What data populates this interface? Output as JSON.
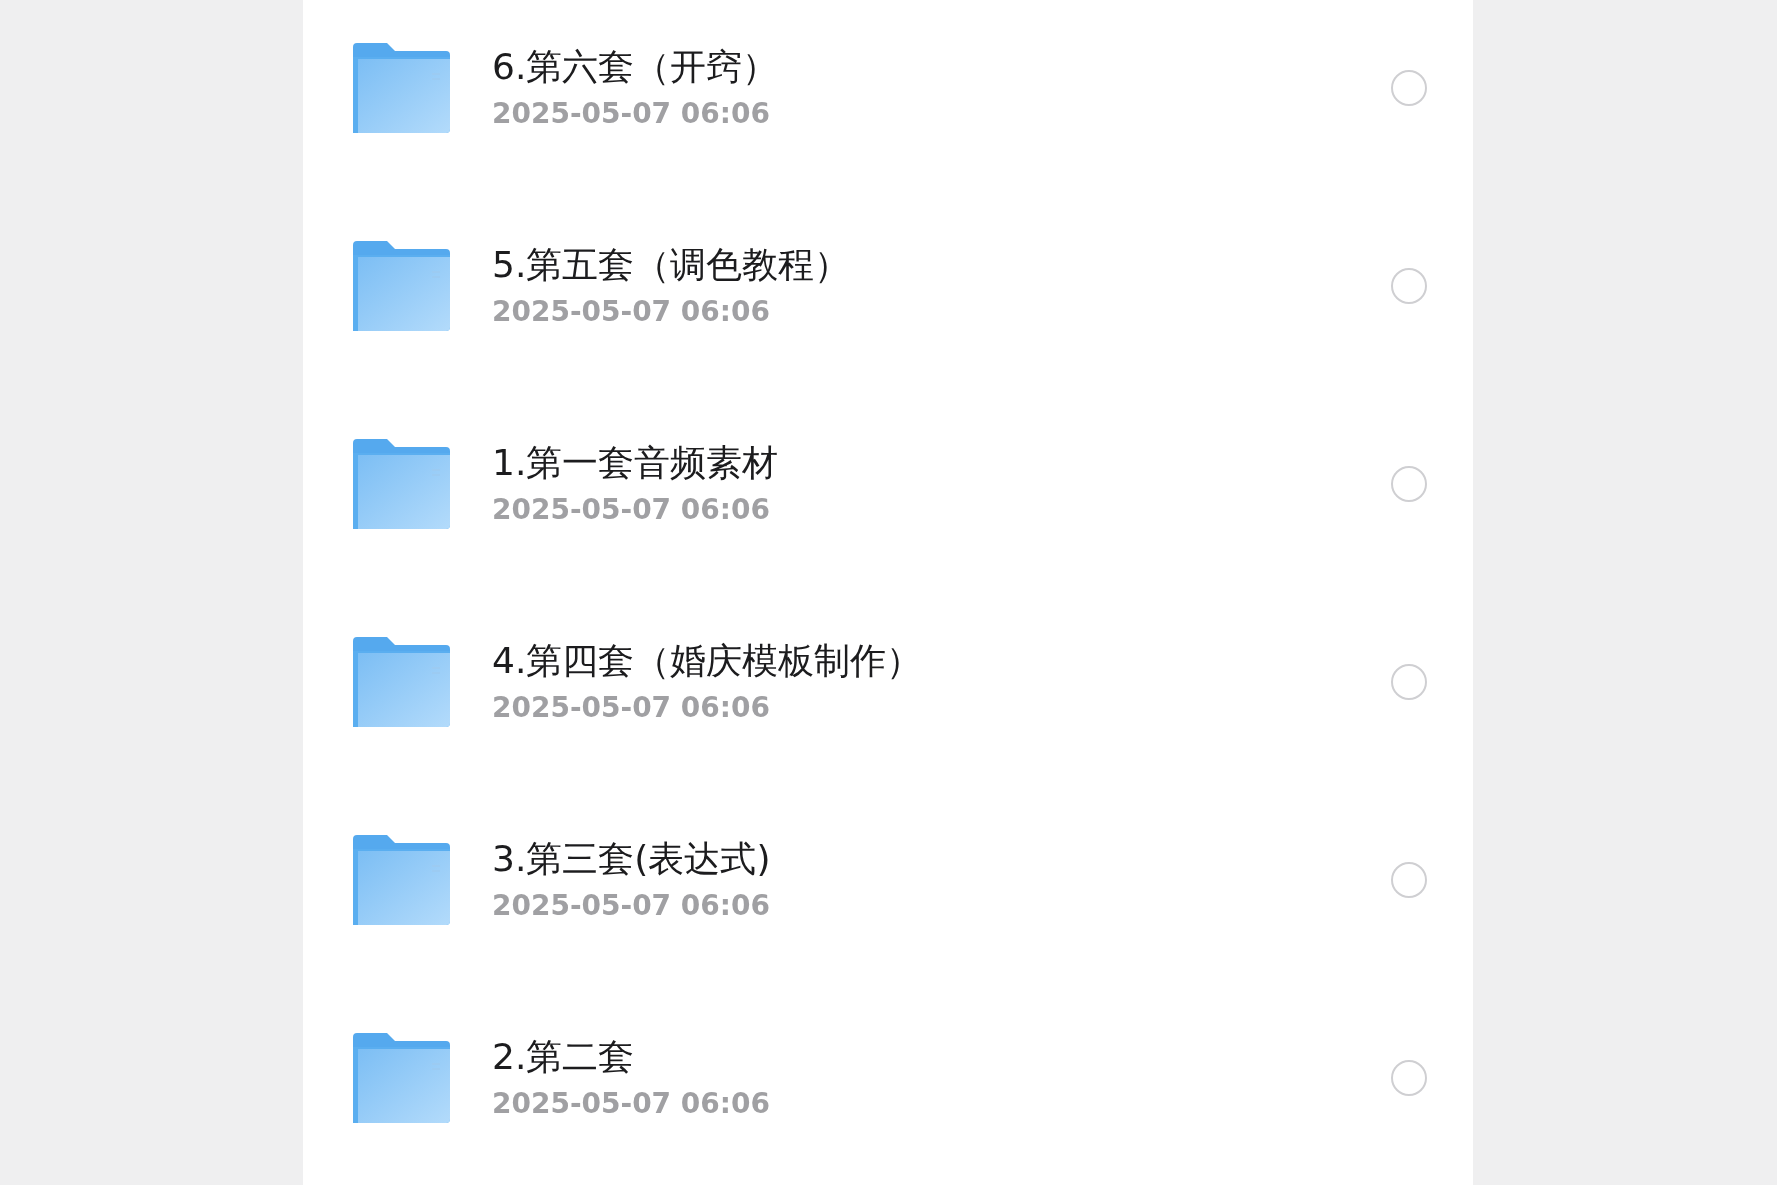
{
  "files": [
    {
      "title": "6.第六套（开窍）",
      "date": "2025-05-07 06:06",
      "selected": false
    },
    {
      "title": "5.第五套（调色教程）",
      "date": "2025-05-07 06:06",
      "selected": false
    },
    {
      "title": "1.第一套音频素材",
      "date": "2025-05-07 06:06",
      "selected": false
    },
    {
      "title": "4.第四套（婚庆模板制作）",
      "date": "2025-05-07 06:06",
      "selected": false
    },
    {
      "title": "3.第三套(表达式)",
      "date": "2025-05-07 06:06",
      "selected": false
    },
    {
      "title": "2.第二套",
      "date": "2025-05-07 06:06",
      "selected": false
    }
  ]
}
